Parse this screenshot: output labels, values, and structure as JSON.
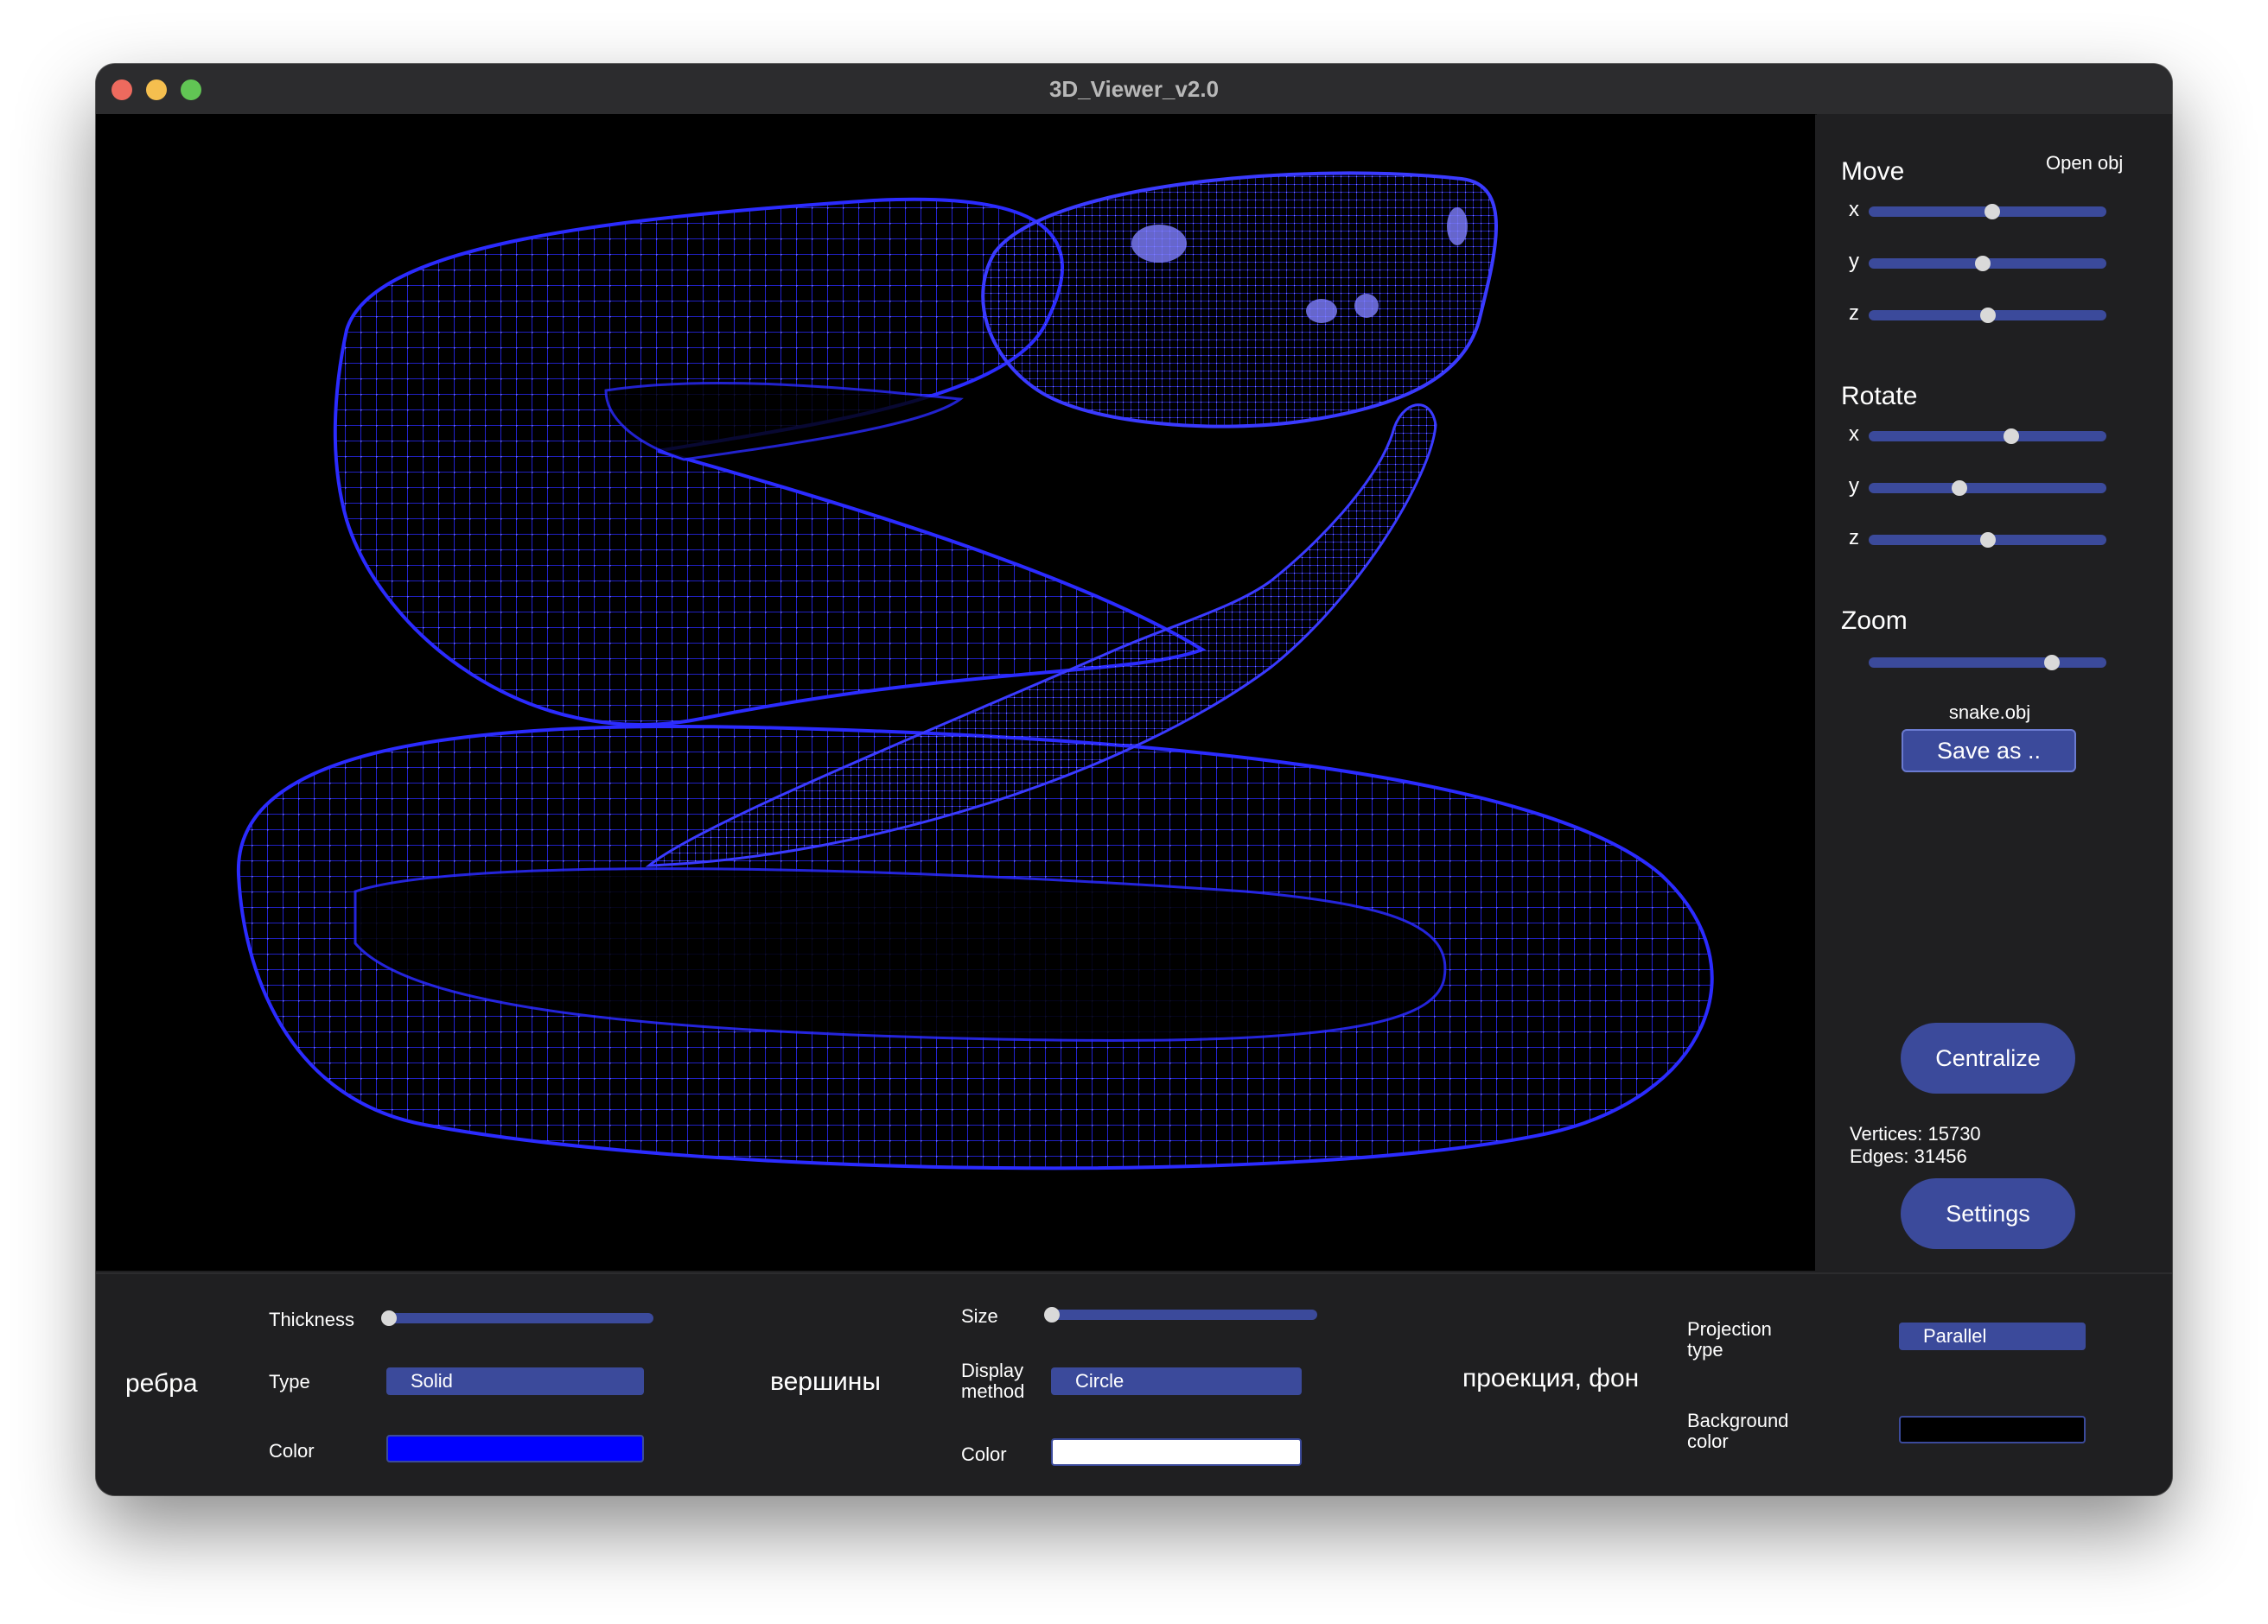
{
  "window": {
    "title": "3D_Viewer_v2.0"
  },
  "side": {
    "open_obj_label": "Open obj",
    "move": {
      "title": "Move",
      "x": {
        "label": "x",
        "value": 0.52
      },
      "y": {
        "label": "y",
        "value": 0.48
      },
      "z": {
        "label": "z",
        "value": 0.5
      }
    },
    "rotate": {
      "title": "Rotate",
      "x": {
        "label": "x",
        "value": 0.6
      },
      "y": {
        "label": "y",
        "value": 0.38
      },
      "z": {
        "label": "z",
        "value": 0.5
      }
    },
    "zoom": {
      "title": "Zoom",
      "value": 0.77
    },
    "filename": "snake.obj",
    "save_as_label": "Save as ..",
    "centralize_label": "Centralize",
    "vertices_text": "Vertices: 15730",
    "edges_text": "Edges: 31456",
    "settings_label": "Settings"
  },
  "edges_panel": {
    "title": "ребра",
    "thickness_label": "Thickness",
    "thickness_value": 0.0,
    "type_label": "Type",
    "type_value": "Solid",
    "color_label": "Color",
    "color": "#0000ff"
  },
  "vertices_panel": {
    "title": "вершины",
    "size_label": "Size",
    "size_value": 0.0,
    "display_method_label": "Display method",
    "display_method_value": "Circle",
    "color_label": "Color",
    "color": "#ffffff"
  },
  "projection_panel": {
    "title": "проекция, фон",
    "projection_type_label": "Projection type",
    "projection_type_value": "Parallel",
    "background_color_label": "Background color",
    "background_color": "#000000"
  },
  "colors": {
    "accent": "#3b4a9b",
    "wireframe": "#1a1aff",
    "panel_bg": "#1f1f21"
  }
}
